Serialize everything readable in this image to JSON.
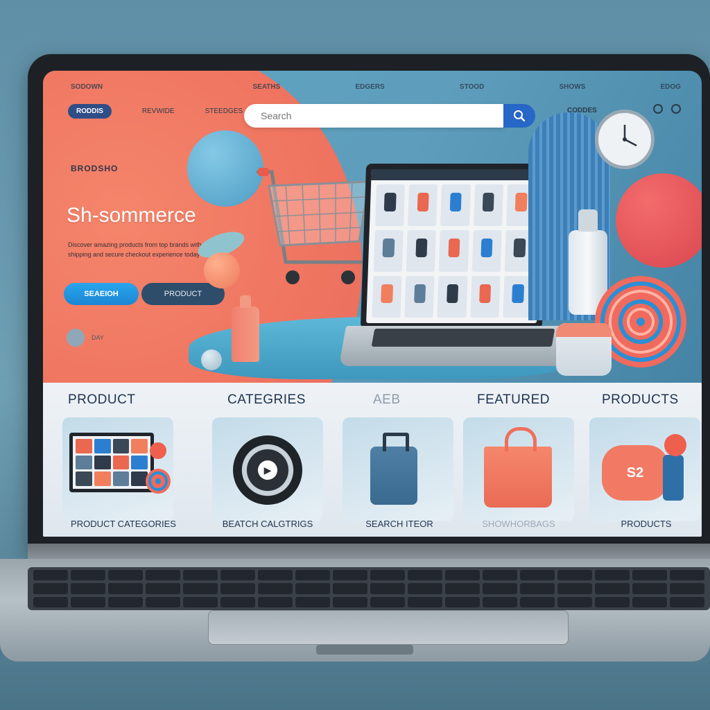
{
  "nav": {
    "top": [
      "SODOWN",
      "",
      "SEATHS",
      "EDGERS",
      "STOOD",
      "SHOWS",
      "EDOG"
    ],
    "pill": "RODDIS",
    "links": [
      "REVWIDE",
      "STEEDGES"
    ],
    "right": [
      "CODDES"
    ]
  },
  "search": {
    "placeholder": "Search"
  },
  "hero": {
    "eyebrow": "BRODSHO",
    "title": "Sh-sommerce",
    "description": "Discover amazing products from top brands with fast shipping and secure checkout experience today",
    "primary_button": "SEAEIOH",
    "secondary_button": "PRODUCT",
    "small_label": "DAY"
  },
  "sections": {
    "headings": [
      "PRODUCT",
      "CATEGRIES",
      "AEB",
      "FEATURED",
      "PRODUCTS"
    ]
  },
  "cards": [
    {
      "caption": "PRODUCT CATEGORIES"
    },
    {
      "caption": "BEATCH CALGTRIGS"
    },
    {
      "caption": "SEARCH ITEOR"
    },
    {
      "caption": "SHOWHORBAGS"
    },
    {
      "caption": "PRODUCTS",
      "badge": "S2"
    }
  ],
  "colors": {
    "accent_blue": "#2767c7",
    "coral": "#ef7460",
    "navy": "#2f4d86"
  },
  "icons": {
    "search": "magnifier",
    "cart": "shopping-cart",
    "clock": "wall-clock"
  }
}
